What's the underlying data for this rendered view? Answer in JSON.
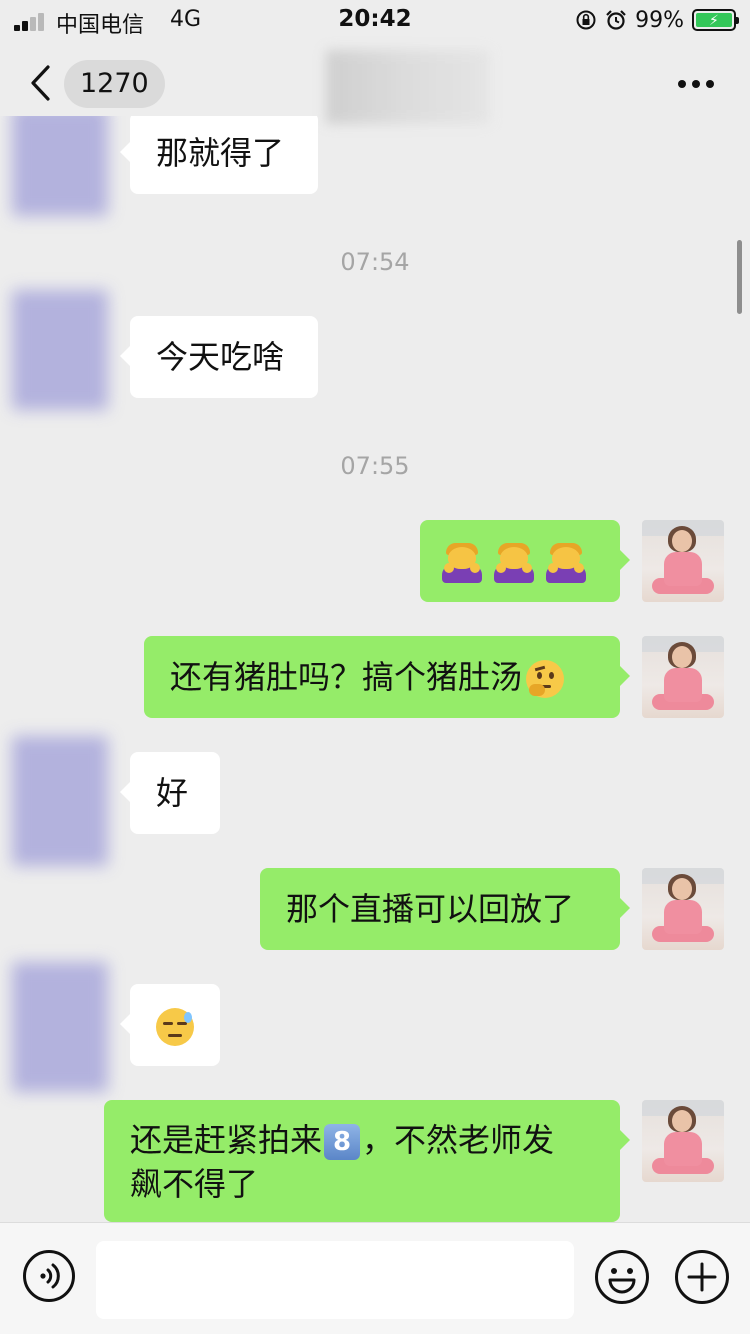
{
  "status_bar": {
    "carrier": "中国电信",
    "network": "4G",
    "time": "20:42",
    "battery": "99%"
  },
  "nav": {
    "unread_count": "1270"
  },
  "messages": {
    "m1": "那就得了",
    "ts1": "07:54",
    "m2": "今天吃啥",
    "ts2": "07:55",
    "m4_text": "还有猪肚吗？搞个猪肚汤",
    "m5": "好",
    "m6": "那个直播可以回放了",
    "m8_part1": "还是赶紧拍来",
    "m8_keycap": "8",
    "m8_part2": "，不然老师发",
    "m8_line2": "飙不得了"
  },
  "colors": {
    "background": "#ededed",
    "bubble_self": "#95ec69",
    "bubble_other": "#ffffff",
    "battery_fill": "#34c759"
  }
}
